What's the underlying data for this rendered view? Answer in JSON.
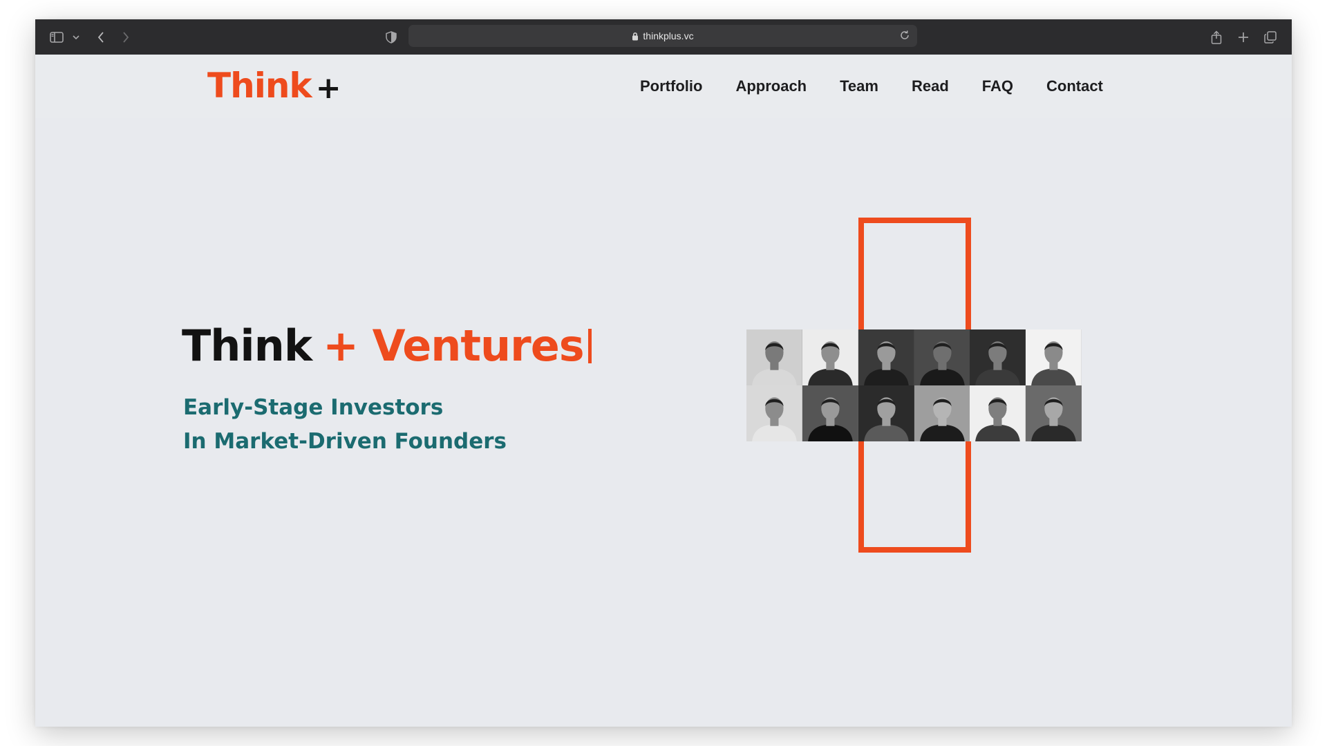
{
  "browser": {
    "url": "thinkplus.vc",
    "icons": {
      "sidebar": "sidebar-icon",
      "chevron": "chevron-down-icon",
      "back": "back-arrow-icon",
      "forward": "forward-arrow-icon",
      "shield": "privacy-shield-icon",
      "lock": "lock-icon",
      "reload": "reload-icon",
      "share": "share-icon",
      "new_tab": "plus-icon",
      "tabs": "tab-overview-icon"
    }
  },
  "header": {
    "logo_text": "Think",
    "logo_plus": "+",
    "nav": [
      "Portfolio",
      "Approach",
      "Team",
      "Read",
      "FAQ",
      "Contact"
    ]
  },
  "hero": {
    "title_black": "Think",
    "title_orange": "+ Ventures",
    "subtitle_line1": "Early-Stage Investors",
    "subtitle_line2": "In Market-Driven Founders"
  },
  "team_photos": [
    {
      "bg": "#cfcfcf",
      "skin": "#7a7a7a",
      "shirt": "#d8d8d8"
    },
    {
      "bg": "#ececec",
      "skin": "#8e8e8e",
      "shirt": "#2a2a2a"
    },
    {
      "bg": "#3a3a3a",
      "skin": "#9a9a9a",
      "shirt": "#1e1e1e"
    },
    {
      "bg": "#4a4a4a",
      "skin": "#6f6f6f",
      "shirt": "#1a1a1a"
    },
    {
      "bg": "#2e2e2e",
      "skin": "#7c7c7c",
      "shirt": "#3a3a3a"
    },
    {
      "bg": "#f2f2f2",
      "skin": "#8a8a8a",
      "shirt": "#4a4a4a"
    },
    {
      "bg": "#d9d9d9",
      "skin": "#8c8c8c",
      "shirt": "#e6e6e6"
    },
    {
      "bg": "#555555",
      "skin": "#9a9a9a",
      "shirt": "#111111"
    },
    {
      "bg": "#2b2b2b",
      "skin": "#a0a0a0",
      "shirt": "#5a5a5a"
    },
    {
      "bg": "#9e9e9e",
      "skin": "#b5b5b5",
      "shirt": "#1c1c1c"
    },
    {
      "bg": "#efefef",
      "skin": "#7e7e7e",
      "shirt": "#3c3c3c"
    },
    {
      "bg": "#6a6a6a",
      "skin": "#a8a8a8",
      "shirt": "#2a2a2a"
    }
  ],
  "colors": {
    "accent": "#ee4b1d",
    "teal": "#1b6b70",
    "page_bg": "#e8eaee"
  }
}
